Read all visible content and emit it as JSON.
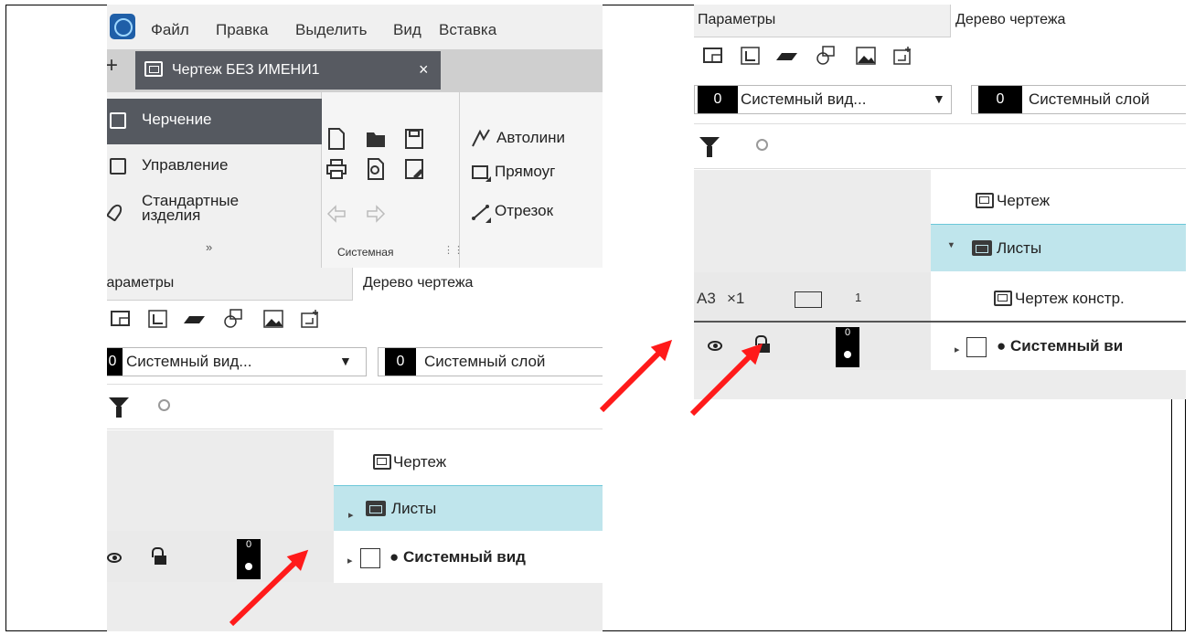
{
  "app": {
    "menu": [
      "Файл",
      "Правка",
      "Выделить",
      "Вид",
      "Вставка"
    ],
    "document_tab": "Чертеж БЕЗ ИМЕНИ1",
    "plus": "+",
    "close": "×"
  },
  "ribbon": {
    "nav": [
      {
        "label": "Черчение",
        "selected": true
      },
      {
        "label": "Управление",
        "selected": false
      },
      {
        "label": "Стандартные изделия",
        "selected": false
      }
    ],
    "group_label": "Системная",
    "tools": [
      "Автолини",
      "Прямоуг",
      "Отрезок"
    ],
    "expand": "»"
  },
  "panel": {
    "tab_params": "Параметры",
    "tab_params_cut": "Іараметры",
    "tab_tree": "Дерево чертежа",
    "view_select": {
      "num": "0",
      "label": "Системный вид..."
    },
    "layer_select": {
      "num": "0",
      "label": "Системный слой"
    },
    "layer_select_cut": {
      "num": "0",
      "label": "Системный слой"
    }
  },
  "tree": {
    "root": "Чертеж",
    "sheets": "Листы",
    "sheet_item": "Чертеж констр.",
    "view": "● Системный вид",
    "view_cut": "● Системный ви",
    "layer_badge": "0",
    "sheet_format": "A3",
    "sheet_scale": "×1",
    "sheet_count": "1"
  },
  "colors": {
    "arrow": "#ff1a1a",
    "selected_row": "#bfe5ec",
    "nav_selected": "#555960"
  }
}
